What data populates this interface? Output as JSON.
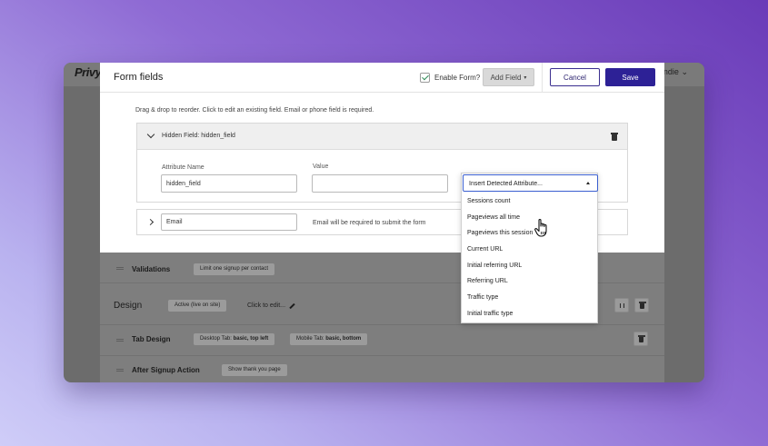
{
  "bg": {
    "logo": "Privy",
    "user_label": "andie"
  },
  "header": {
    "title": "Form fields",
    "enable_label": "Enable Form?",
    "add_field_label": "Add Field",
    "cancel_label": "Cancel",
    "save_label": "Save"
  },
  "form": {
    "instructions": "Drag & drop to reorder. Click to edit an existing field. Email or phone field is required.",
    "hidden_field": {
      "header_label": "Hidden Field: hidden_field",
      "attr_label": "Attribute Name",
      "attr_value": "hidden_field",
      "value_label": "Value",
      "value_value": ""
    },
    "email_field": {
      "input_value": "Email",
      "note": "Email will be required to submit the form"
    }
  },
  "sections": {
    "validations": {
      "label": "Validations",
      "tag": "Limit one signup per contact"
    },
    "design": {
      "label": "Design",
      "status_tag": "Active (live on site)",
      "edit_label": "Click to edit..."
    },
    "tab_design": {
      "label": "Tab Design",
      "desktop_prefix": "Desktop Tab: ",
      "desktop_value": "basic, top left",
      "mobile_prefix": "Mobile Tab: ",
      "mobile_value": "basic, bottom"
    },
    "after_signup": {
      "label": "After Signup Action",
      "tag": "Show thank you page"
    }
  },
  "dropdown": {
    "selected": "Insert Detected Attribute...",
    "options": [
      "Sessions count",
      "Pageviews all time",
      "Pageviews this session",
      "Current URL",
      "Initial referring URL",
      "Referring URL",
      "Traffic type",
      "Initial traffic type"
    ]
  },
  "colors": {
    "primary": "#2d2196",
    "select_border": "#3a5fd0",
    "check": "#2e8b57"
  },
  "icons": [
    "check-icon",
    "caret-down-icon",
    "chevron-down-icon",
    "chevron-right-icon",
    "trash-icon",
    "pencil-icon",
    "pause-icon",
    "caret-up-icon",
    "hand-cursor-icon"
  ]
}
